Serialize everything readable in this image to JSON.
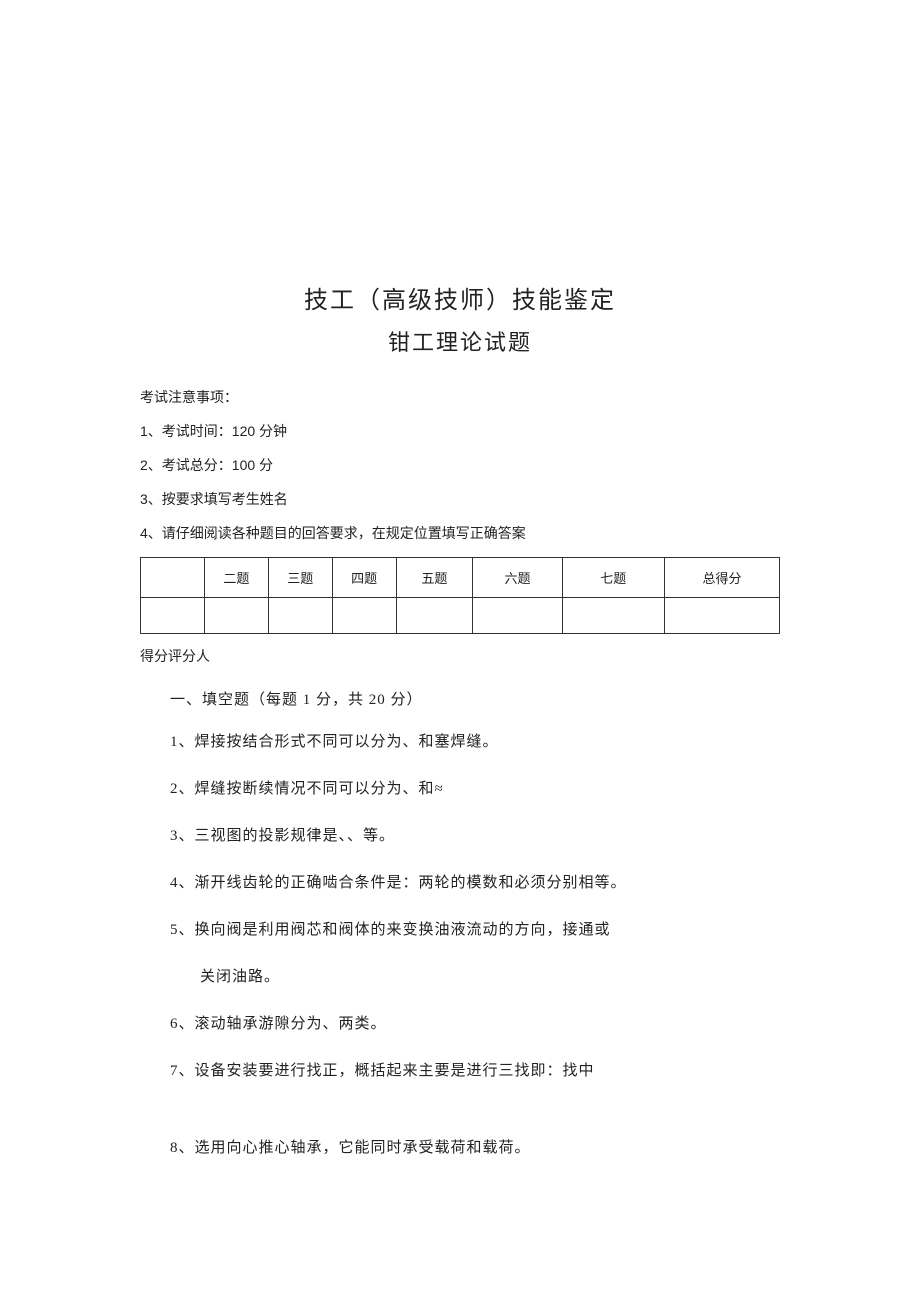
{
  "title": "技工（高级技师）技能鉴定",
  "subtitle": "钳工理论试题",
  "notice_header": "考试注意事项：",
  "notices": [
    "1、考试时间：120 分钟",
    "2、考试总分：100 分",
    "3、按要求填写考生姓名",
    "4、请仔细阅读各种题目的回答要求，在规定位置填写正确答案"
  ],
  "table_headers": [
    "",
    "二题",
    "三题",
    "四题",
    "五题",
    "六题",
    "七题",
    "总得分"
  ],
  "score_footer": "得分评分人",
  "section_title": "一、填空题（每题 1 分，共 20 分）",
  "questions": [
    {
      "text": "1、焊接按结合形式不同可以分为、和塞焊缝。"
    },
    {
      "text": "2、焊缝按断续情况不同可以分为、和≈"
    },
    {
      "text": "3、三视图的投影规律是、、等。"
    },
    {
      "text": "4、渐开线齿轮的正确啮合条件是：两轮的模数和必须分别相等。"
    },
    {
      "text": "5、换向阀是利用阀芯和阀体的来变换油液流动的方向，接通或",
      "cont": "关闭油路。"
    },
    {
      "text": "6、滚动轴承游隙分为、两类。"
    },
    {
      "text": "7、设备安装要进行找正，概括起来主要是进行三找即：找中"
    },
    {
      "text": "8、选用向心推心轴承，它能同时承受载荷和载荷。"
    }
  ]
}
